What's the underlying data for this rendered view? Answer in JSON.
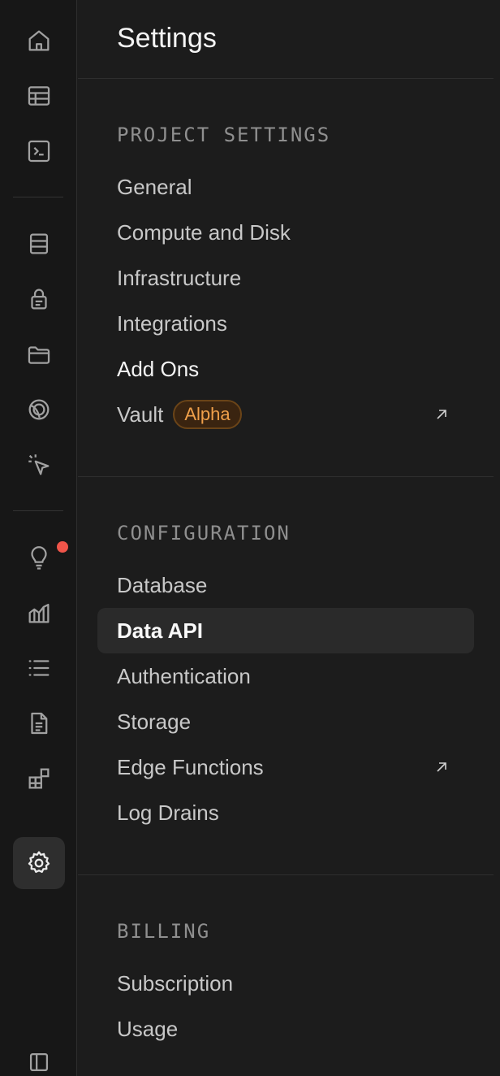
{
  "rail": {
    "icons": [
      "home-icon",
      "table-editor-icon",
      "sql-editor-icon",
      "database-icon",
      "auth-lock-icon",
      "storage-folder-icon",
      "realtime-icon",
      "cursor-click-icon",
      "advisors-lightbulb-icon",
      "reports-chart-icon",
      "logs-list-icon",
      "docs-file-icon",
      "integrations-blocks-icon",
      "settings-gear-icon"
    ],
    "active": "settings-gear-icon"
  },
  "panel": {
    "title": "Settings",
    "sections": [
      {
        "label": "PROJECT SETTINGS",
        "items": [
          "General",
          "Compute and Disk",
          "Infrastructure",
          "Integrations",
          "Add Ons",
          "Vault"
        ]
      },
      {
        "label": "CONFIGURATION",
        "items": [
          "Database",
          "Data API",
          "Authentication",
          "Storage",
          "Edge Functions",
          "Log Drains"
        ]
      },
      {
        "label": "BILLING",
        "items": [
          "Subscription",
          "Usage"
        ]
      }
    ],
    "vault_badge": "Alpha",
    "selected_item": "Data API"
  },
  "colors": {
    "background": "#1c1c1c",
    "rail": "#171717",
    "badge": "#f0a04a",
    "notification": "#f0554a"
  }
}
